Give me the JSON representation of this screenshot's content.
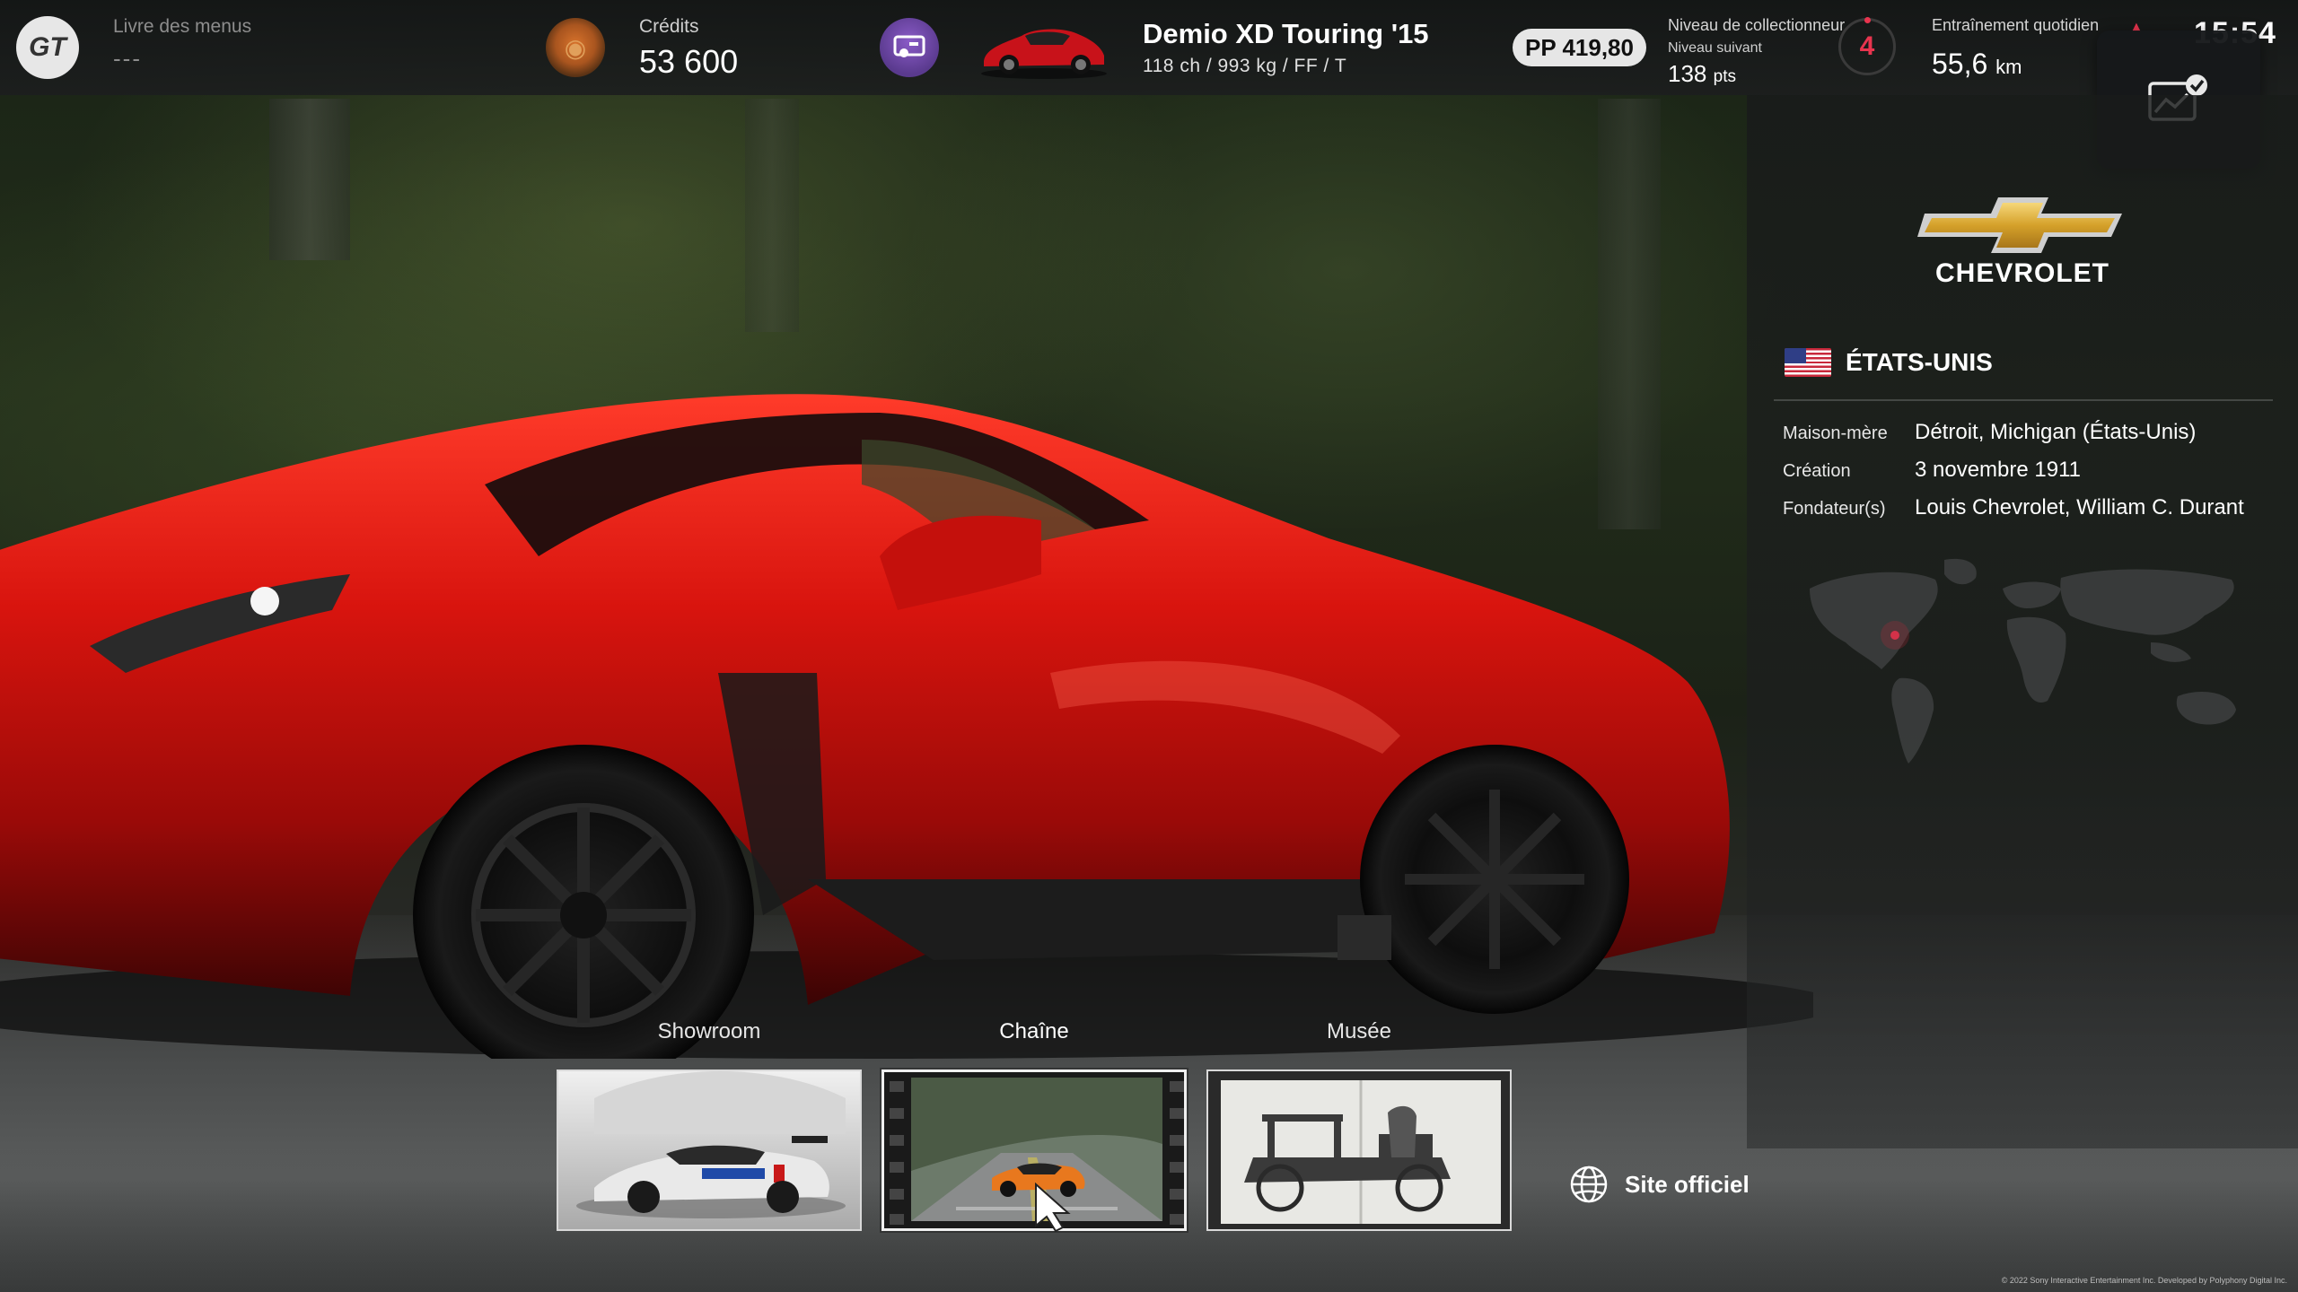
{
  "topbar": {
    "logo_text": "GT",
    "menu_book_label": "Livre des menus",
    "menu_book_value": "---",
    "credits_label": "Crédits",
    "credits_value": "53 600",
    "car_name": "Demio XD Touring '15",
    "car_specs": "118 ch / 993 kg / FF / T",
    "pp": "PP 419,80",
    "collector_label": "Niveau de collectionneur",
    "collector_next_label": "Niveau suivant",
    "collector_next_value": "138",
    "collector_next_unit": "pts",
    "collector_level": "4",
    "daily_label": "Entraînement quotidien",
    "daily_value": "55,6",
    "daily_unit": "km",
    "clock": "15:54"
  },
  "brand": {
    "name": "CHEVROLET",
    "country": "ÉTATS-UNIS",
    "info": [
      {
        "key": "Maison-mère",
        "value": "Détroit, Michigan (États-Unis)"
      },
      {
        "key": "Création",
        "value": "3 novembre 1911"
      },
      {
        "key": "Fondateur(s)",
        "value": "Louis Chevrolet, William C. Durant"
      }
    ]
  },
  "tabs": [
    {
      "label": "Showroom",
      "active": false
    },
    {
      "label": "Chaîne",
      "active": true
    },
    {
      "label": "Musée",
      "active": false
    }
  ],
  "official_site": "Site officiel",
  "copyright": "© 2022 Sony Interactive Entertainment Inc. Developed by Polyphony Digital Inc.",
  "icons": {
    "gt_logo": "gt-logo-icon",
    "coin": "credits-coin-icon",
    "garage": "garage-icon",
    "notification": "stats-check-icon",
    "globe": "globe-icon"
  },
  "colors": {
    "accent_red": "#e8344e",
    "car_red": "#c8120f",
    "panel_bg": "#1a1c1c"
  }
}
